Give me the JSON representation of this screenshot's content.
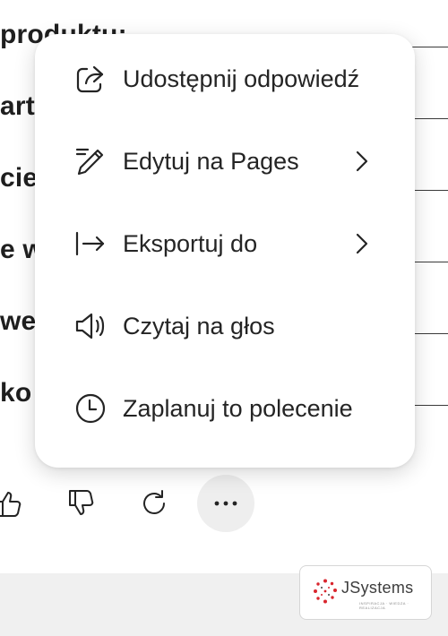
{
  "background": {
    "lines": [
      {
        "text": " produktu:"
      },
      {
        "text": "art"
      },
      {
        "text": "cie"
      },
      {
        "text": "e w"
      },
      {
        "text": "we"
      },
      {
        "text": " ko"
      }
    ]
  },
  "menu": {
    "items": [
      {
        "label": "Udostępnij odpowiedź",
        "icon": "share-icon",
        "has_submenu": false
      },
      {
        "label": "Edytuj na Pages",
        "icon": "pencil-icon",
        "has_submenu": true
      },
      {
        "label": "Eksportuj do",
        "icon": "export-arrow-icon",
        "has_submenu": true
      },
      {
        "label": "Czytaj na głos",
        "icon": "speaker-icon",
        "has_submenu": false
      },
      {
        "label": "Zaplanuj to polecenie",
        "icon": "clock-icon",
        "has_submenu": false
      }
    ]
  },
  "actions": {
    "items": [
      {
        "icon": "thumbs-up-icon"
      },
      {
        "icon": "thumbs-down-icon"
      },
      {
        "icon": "regenerate-icon"
      },
      {
        "icon": "more-options-icon",
        "active": true
      }
    ]
  },
  "footer": {
    "logo_text": "JSystems",
    "logo_tagline": "INSPIRACJA · WIEDZA · REALIZACJA"
  },
  "colors": {
    "menu_bg": "#ffffff",
    "text": "#242424",
    "footer_bg": "#f0f0f0",
    "logo_red": "#d9262e"
  }
}
